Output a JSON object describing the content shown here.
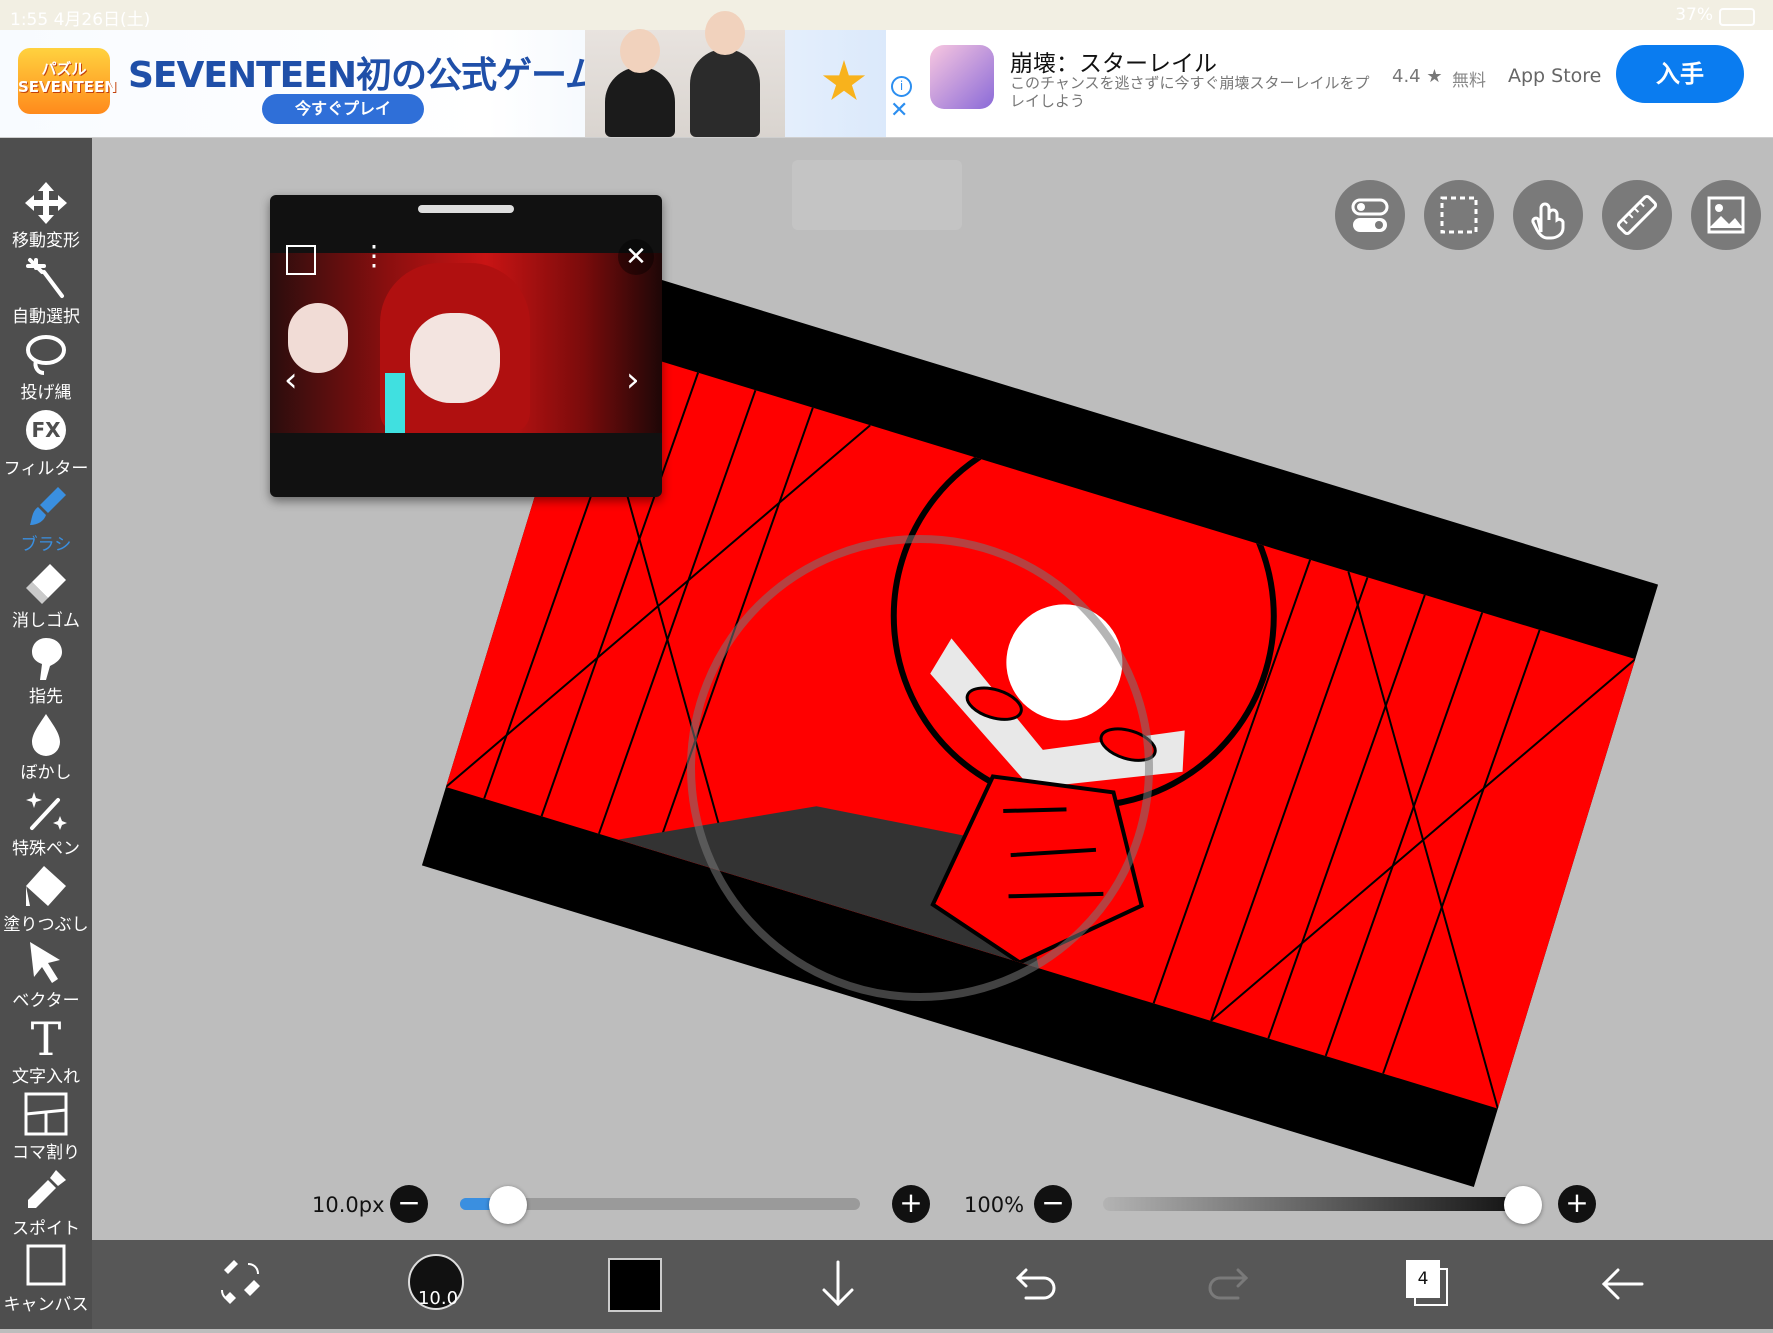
{
  "status_bar": {
    "time": "1:55 4月26日(土)",
    "battery": "37%"
  },
  "ad": {
    "game_logo": "パズル SEVENTEEN",
    "headline": "SEVENTEEN初の公式ゲーム",
    "play_label": "今すぐプレイ",
    "app_title": "崩壊：スターレイル",
    "app_description": "このチャンスを逃さずに今すぐ崩壊スターレイルをプレイしよう",
    "rating": "4.4 ★",
    "price": "無料",
    "store": "App Store",
    "get_label": "入手"
  },
  "tools": [
    {
      "label": "移動変形",
      "icon": "move-icon"
    },
    {
      "label": "自動選択",
      "icon": "magic-wand-icon"
    },
    {
      "label": "投げ縄",
      "icon": "lasso-icon"
    },
    {
      "label": "フィルター",
      "icon": "filter-fx-icon",
      "icon_text": "FX"
    },
    {
      "label": "ブラシ",
      "icon": "brush-icon",
      "active": true
    },
    {
      "label": "消しゴム",
      "icon": "eraser-icon"
    },
    {
      "label": "指先",
      "icon": "finger-icon"
    },
    {
      "label": "ぼかし",
      "icon": "blur-icon"
    },
    {
      "label": "特殊ペン",
      "icon": "special-pen-icon"
    },
    {
      "label": "塗りつぶし",
      "icon": "fill-icon"
    },
    {
      "label": "ベクター",
      "icon": "vector-icon"
    },
    {
      "label": "文字入れ",
      "icon": "text-icon",
      "icon_text": "T"
    },
    {
      "label": "コマ割り",
      "icon": "frame-divider-icon"
    },
    {
      "label": "スポイト",
      "icon": "eyedropper-icon"
    },
    {
      "label": "キャンバス",
      "icon": "canvas-icon"
    }
  ],
  "brush": {
    "size_label": "10.0px",
    "size_badge": "10.0",
    "size_fraction": 0.12,
    "opacity_label": "100%",
    "opacity_fraction": 1.0
  },
  "layers": {
    "count": "4"
  },
  "colors": {
    "accent": "#3a8fe0",
    "canvas_red": "#ff0000",
    "toolbar": "#4e4e4e",
    "current_color": "#000000"
  }
}
